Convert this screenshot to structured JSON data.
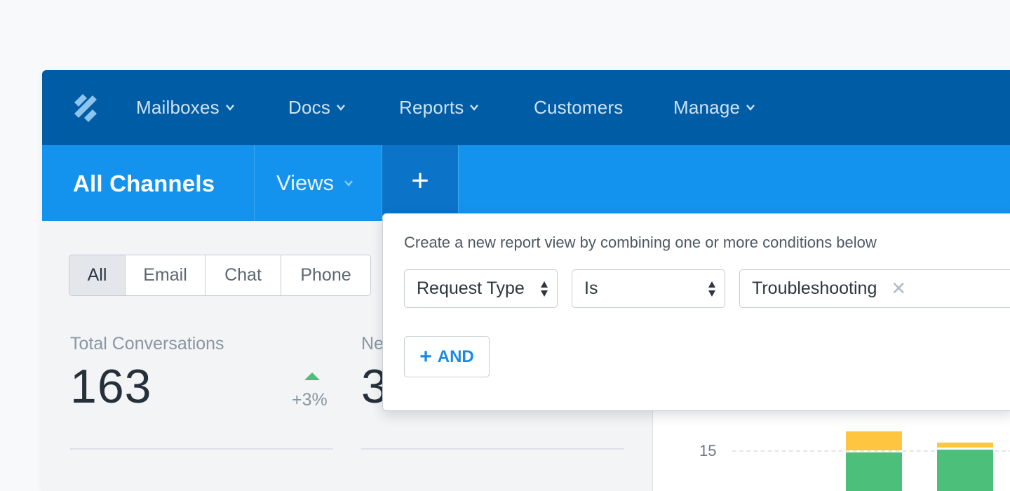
{
  "topnav": {
    "items": [
      {
        "label": "Mailboxes",
        "dropdown": true
      },
      {
        "label": "Docs",
        "dropdown": true
      },
      {
        "label": "Reports",
        "dropdown": true
      },
      {
        "label": "Customers",
        "dropdown": false
      },
      {
        "label": "Manage",
        "dropdown": true
      }
    ],
    "logo_icon": "help-scout-logo-icon"
  },
  "subbar": {
    "title": "All Channels",
    "views_label": "Views",
    "add_label": "+"
  },
  "filters": {
    "items": [
      "All",
      "Email",
      "Chat",
      "Phone"
    ],
    "selected": "All"
  },
  "stats": {
    "total": {
      "label": "Total Conversations",
      "value": "163",
      "trend": "+3%"
    },
    "second": {
      "label_visible": "Ne",
      "value_visible": "3"
    }
  },
  "chart": {
    "ytick": "15",
    "colors": {
      "yellow": "#fec540",
      "green": "#4cbf7a"
    }
  },
  "popover": {
    "description": "Create a new report view by combining one or more conditions below",
    "field_select": "Request Type",
    "operator_select": "Is",
    "value_tag": "Troubleshooting",
    "remove_glyph": "✕",
    "and_button": "AND",
    "and_plus": "+"
  },
  "colors": {
    "nav_bg": "#005ca4",
    "subbar_bg": "#1493ee",
    "accent": "#1a8ae3",
    "trend_up": "#4cbf7a"
  }
}
